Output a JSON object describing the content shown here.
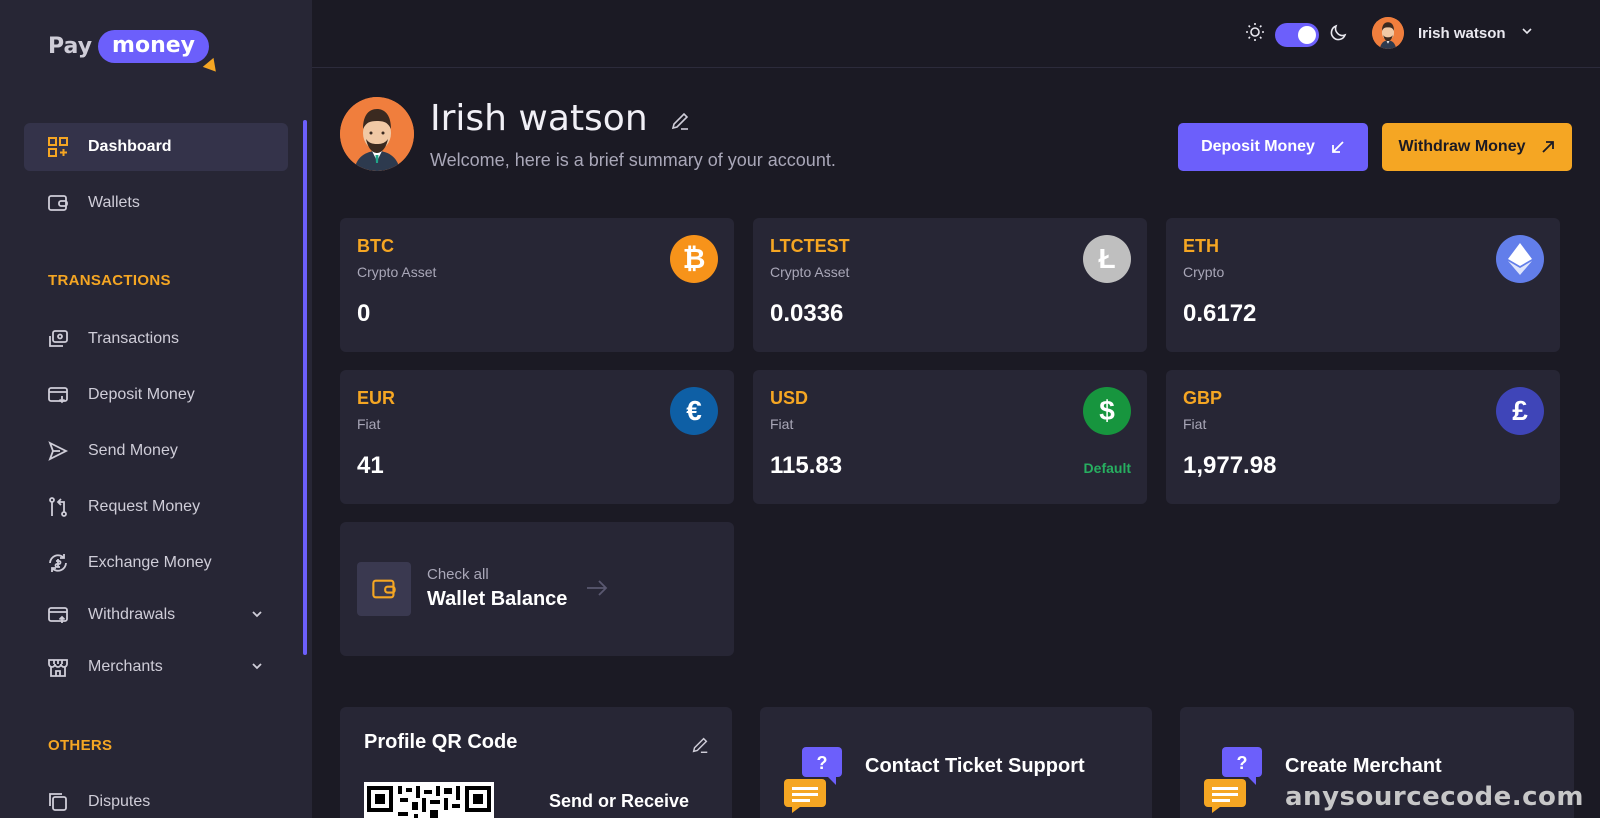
{
  "logo": {
    "pay": "Pay",
    "money": "money"
  },
  "sidebar": {
    "items": [
      {
        "label": "Dashboard",
        "icon": "dashboard-icon"
      },
      {
        "label": "Wallets",
        "icon": "wallet-icon"
      }
    ],
    "sections": {
      "transactions": "TRANSACTIONS",
      "others": "OTHERS"
    },
    "transaction_items": [
      {
        "label": "Transactions",
        "icon": "transactions-icon"
      },
      {
        "label": "Deposit Money",
        "icon": "deposit-icon"
      },
      {
        "label": "Send Money",
        "icon": "send-icon"
      },
      {
        "label": "Request Money",
        "icon": "request-icon"
      },
      {
        "label": "Exchange Money",
        "icon": "exchange-icon"
      },
      {
        "label": "Withdrawals",
        "icon": "withdraw-icon"
      },
      {
        "label": "Merchants",
        "icon": "store-icon"
      }
    ],
    "other_items": [
      {
        "label": "Disputes",
        "icon": "disputes-icon"
      }
    ]
  },
  "topbar": {
    "user_name": "Irish watson"
  },
  "header": {
    "name": "Irish watson",
    "welcome": "Welcome, here is a brief summary of your account.",
    "deposit_label": "Deposit Money",
    "withdraw_label": "Withdraw Money"
  },
  "wallets": [
    {
      "code": "BTC",
      "kind": "Crypto Asset",
      "amount": "0",
      "symbol": "₿",
      "color": "#f7931a"
    },
    {
      "code": "LTCTEST",
      "kind": "Crypto Asset",
      "amount": "0.0336",
      "symbol": "Ł",
      "color": "#bfbfbf"
    },
    {
      "code": "ETH",
      "kind": "Crypto",
      "amount": "0.6172",
      "symbol": "◆",
      "color": "#627eea"
    },
    {
      "code": "EUR",
      "kind": "Fiat",
      "amount": "41",
      "symbol": "€",
      "color": "#0e5fa5"
    },
    {
      "code": "USD",
      "kind": "Fiat",
      "amount": "115.83",
      "symbol": "$",
      "color": "#17953e",
      "badge": "Default"
    },
    {
      "code": "GBP",
      "kind": "Fiat",
      "amount": "1,977.98",
      "symbol": "£",
      "color": "#3f45b8"
    }
  ],
  "wallet_balance": {
    "small": "Check all",
    "big": "Wallet Balance"
  },
  "bottom_cards": {
    "qr_title": "Profile QR Code",
    "qr_text": "Send or Receive",
    "support_title": "Contact Ticket Support",
    "merchant_title": "Create Merchant"
  },
  "watermark": "anysourcecode.com",
  "colors": {
    "accent": "#6c5ffb",
    "orange": "#f5a623",
    "bg": "#1b1a24",
    "card": "#272635"
  }
}
